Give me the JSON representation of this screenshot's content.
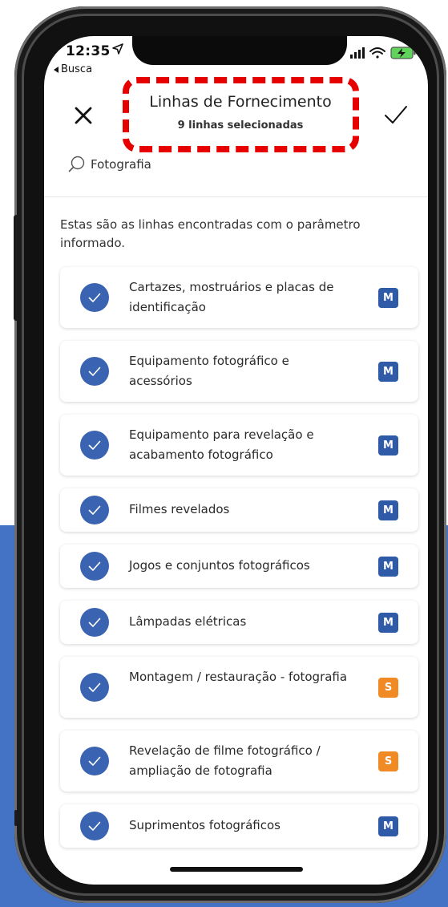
{
  "status_bar": {
    "time": "12:35",
    "back_app_label": "Busca",
    "location_icon": "location-arrow-icon",
    "signal_icon": "cellular-signal-icon",
    "wifi_icon": "wifi-icon",
    "battery_icon": "battery-charging-icon"
  },
  "header": {
    "title": "Linhas de Fornecimento",
    "subtitle": "9 linhas selecionadas",
    "close_icon": "close-icon",
    "confirm_icon": "checkmark-icon",
    "highlight_color": "#e60000"
  },
  "search": {
    "icon": "search-icon",
    "value": "Fotografia"
  },
  "intro_text": "Estas são as linhas encontradas com o parâmetro informado.",
  "items": [
    {
      "label": "Cartazes, mostruários e placas de identificação",
      "badge": "M"
    },
    {
      "label": "Equipamento fotográfico e acessórios",
      "badge": "M"
    },
    {
      "label": "Equipamento para revelação e acabamento fotográfico",
      "badge": "M"
    },
    {
      "label": "Filmes revelados",
      "badge": "M"
    },
    {
      "label": "Jogos e conjuntos fotográficos",
      "badge": "M"
    },
    {
      "label": "Lâmpadas elétricas",
      "badge": "M"
    },
    {
      "label": "Montagem / restauração - fotografia",
      "badge": "S"
    },
    {
      "label": "Revelação de filme fotográfico / ampliação de fotografia",
      "badge": "S"
    },
    {
      "label": "Suprimentos fotográficos",
      "badge": "M"
    }
  ],
  "colors": {
    "accent": "#3a63b1",
    "badge_m": "#2f5aa8",
    "badge_s": "#f08a24",
    "background_band": "#4472c4"
  }
}
